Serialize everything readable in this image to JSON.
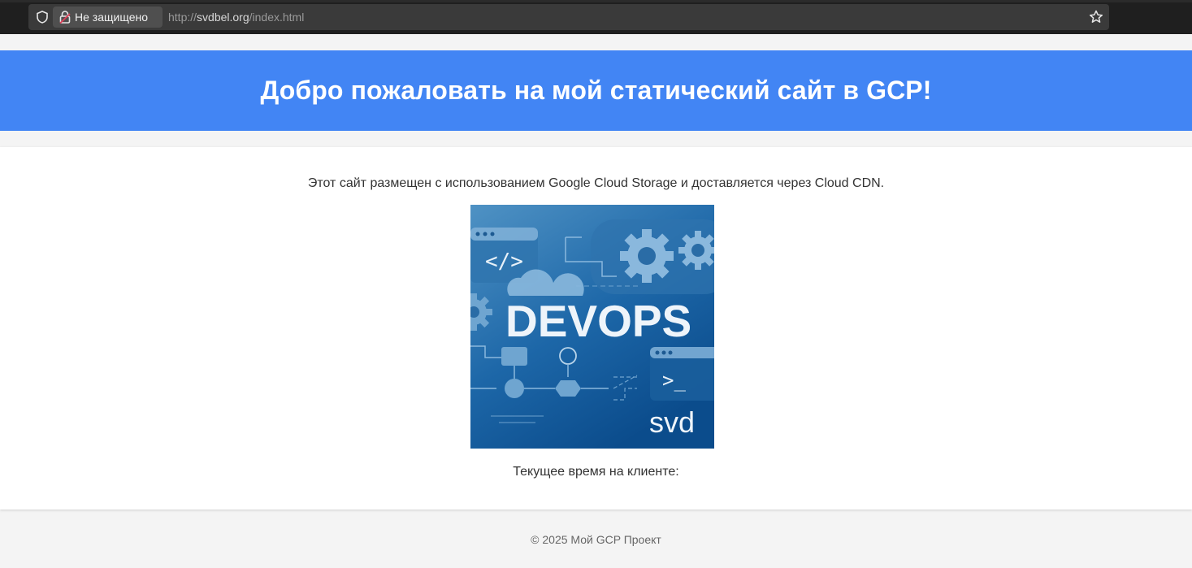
{
  "browser": {
    "security_label": "Не защищено",
    "url_scheme": "http://",
    "url_host": "svdbel.org",
    "url_path": "/index.html"
  },
  "header": {
    "title": "Добро пожаловать на мой статический сайт в GCP!"
  },
  "main": {
    "intro": "Этот сайт размещен с использованием Google Cloud Storage и доставляется через Cloud CDN.",
    "banner": {
      "big_text": "DEVOPS",
      "corner_text": "svd"
    },
    "time_label": "Текущее время на клиенте:"
  },
  "footer": {
    "text": "© 2025 Мой GCP Проект"
  },
  "colors": {
    "header_bg": "#4285f4",
    "page_bg": "#f4f4f4"
  }
}
